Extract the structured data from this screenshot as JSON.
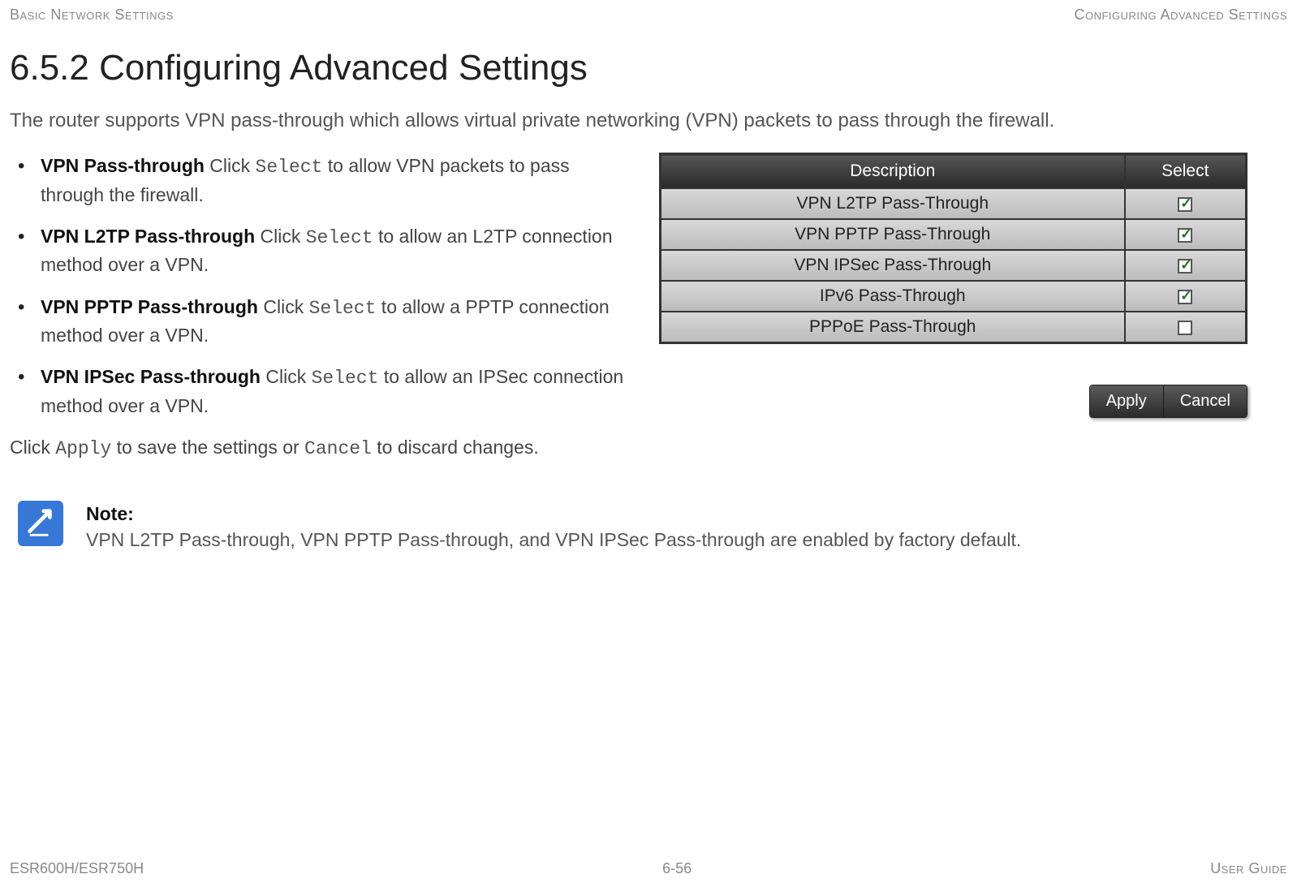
{
  "header": {
    "left": "Basic Network Settings",
    "right": "Configuring Advanced Settings"
  },
  "title": "6.5.2 Configuring Advanced Settings",
  "intro": "The router supports VPN pass-through which allows virtual private networking (VPN) packets to pass through the firewall.",
  "bullets": [
    {
      "term": "VPN Pass-through",
      "pre": "  Click ",
      "mono": "Select",
      "post": " to allow VPN packets to pass through the firewall."
    },
    {
      "term": "VPN L2TP Pass-through",
      "pre": "  Click ",
      "mono": "Select",
      "post": " to allow an L2TP connection method over a VPN."
    },
    {
      "term": "VPN PPTP Pass-through",
      "pre": "  Click ",
      "mono": "Select",
      "post": " to allow a PPTP connection method over a VPN."
    },
    {
      "term": "VPN IPSec Pass-through",
      "pre": "  Click ",
      "mono": "Select",
      "post": " to allow an IPSec connection method over a VPN."
    }
  ],
  "apply_text": {
    "p1": "Click ",
    "m1": "Apply",
    "p2": " to save the settings or ",
    "m2": "Cancel",
    "p3": " to discard changes."
  },
  "table": {
    "headers": {
      "desc": "Description",
      "select": "Select"
    },
    "rows": [
      {
        "desc": "VPN L2TP Pass-Through",
        "checked": true
      },
      {
        "desc": "VPN PPTP Pass-Through",
        "checked": true
      },
      {
        "desc": "VPN IPSec Pass-Through",
        "checked": true
      },
      {
        "desc": "IPv6 Pass-Through",
        "checked": true
      },
      {
        "desc": "PPPoE Pass-Through",
        "checked": false
      }
    ]
  },
  "buttons": {
    "apply": "Apply",
    "cancel": "Cancel"
  },
  "note": {
    "label": "Note:",
    "body": "VPN L2TP Pass-through, VPN PPTP Pass-through, and VPN IPSec Pass-through are enabled by factory default."
  },
  "footer": {
    "left": "ESR600H/ESR750H",
    "center": "6-56",
    "right": "User Guide"
  }
}
